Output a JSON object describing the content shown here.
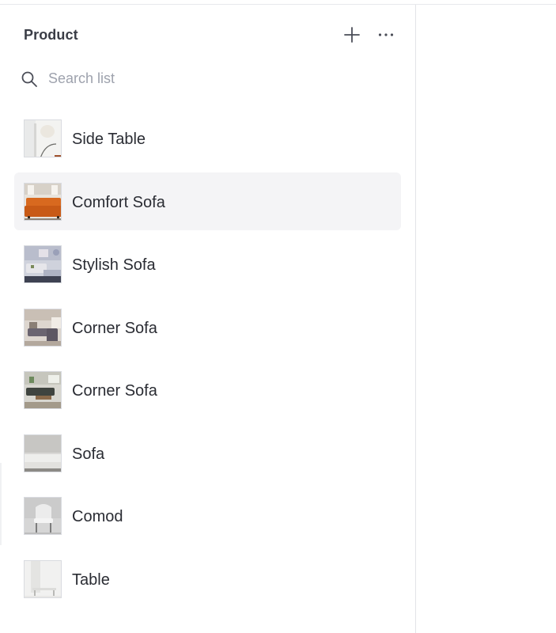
{
  "panel": {
    "title": "Product",
    "add_icon": "plus-icon",
    "more_icon": "more-horizontal-icon"
  },
  "search": {
    "icon": "search-icon",
    "placeholder": "Search list",
    "value": ""
  },
  "products": [
    {
      "name": "Side Table",
      "thumbnail": "side-table-photo",
      "selected": false
    },
    {
      "name": "Comfort Sofa",
      "thumbnail": "comfort-sofa-photo",
      "selected": true
    },
    {
      "name": "Stylish Sofa",
      "thumbnail": "stylish-sofa-photo",
      "selected": false
    },
    {
      "name": "Corner Sofa",
      "thumbnail": "corner-sofa-photo",
      "selected": false
    },
    {
      "name": "Corner Sofa",
      "thumbnail": "corner-sofa-2-photo",
      "selected": false
    },
    {
      "name": "Sofa",
      "thumbnail": "sofa-photo",
      "selected": false
    },
    {
      "name": "Comod",
      "thumbnail": "comod-photo",
      "selected": false
    },
    {
      "name": "Table",
      "thumbnail": "table-photo",
      "selected": false
    }
  ],
  "colors": {
    "selected_row_bg": "#f4f4f6",
    "text": "#2a2c33",
    "placeholder": "#9ea2ad",
    "divider": "#e3e4e8"
  }
}
